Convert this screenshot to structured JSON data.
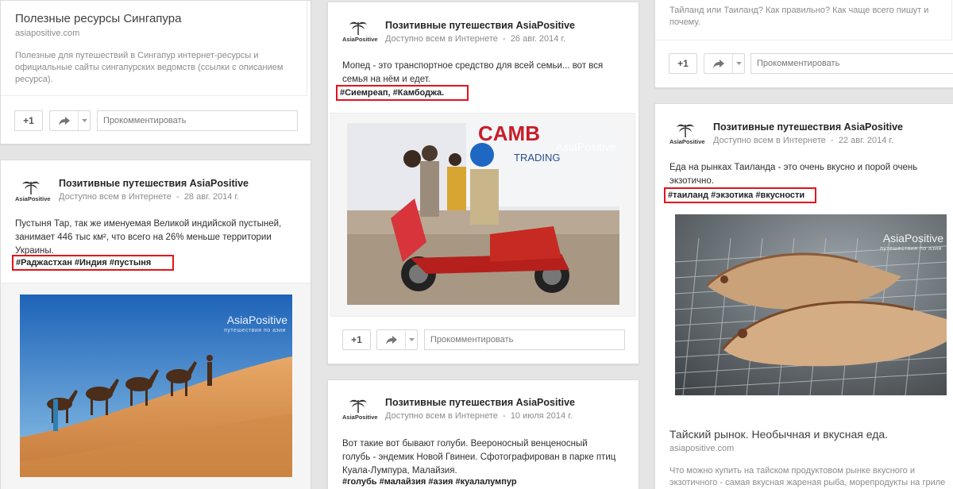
{
  "common": {
    "author": "Позитивные путешествия AsiaPositive",
    "visibility": "Доступно всем в Интернете",
    "plus_one": "+1",
    "comment_placeholder": "Прокомментировать",
    "logo_text": "AsiaPositive",
    "watermark": "AsiaPositive",
    "watermark_sub": "путешествия по азии"
  },
  "posts": [
    {
      "id": "singapore-resources",
      "link_title": "Полезные ресурсы Сингапура",
      "link_domain": "asiapositive.com",
      "link_desc": "Полезные для путешествий в Сингапур интернет-ресурсы и официальные сайты сингапурских ведомств (ссылки с описанием ресурса)."
    },
    {
      "id": "thar-desert",
      "date": "28 авг. 2014 г.",
      "text": "Пустыня Тар, так же именуемая Великой индийской пустыней, занимает 446 тыс км², что всего на 26% меньше территории Украины.",
      "tags": "#Раджастхан   #Индия   #пустыня",
      "photo_alt": "camels in desert"
    },
    {
      "id": "moped-cambodia",
      "date": "26 авг. 2014 г.",
      "text": "Мопед - это транспортное средство для всей семьи... вот вся семья на нём и едет.",
      "tags": "#Сиемреап, #Камбоджа.",
      "photo_alt": "family on moped",
      "sign_text": "CAMB",
      "sign_sub": "TRADING"
    },
    {
      "id": "pigeons",
      "date": "10 июля 2014 г.",
      "text": "Вот такие вот бывают голуби.  Веероносный венценосный голубь - эндемик Новой Гвинеи. Сфотографирован в парке птиц Куала-Лумпура, Малайзия.",
      "tags": "#голубь #малайзия  #азия  #куалалумпур"
    },
    {
      "id": "thailand-spelling",
      "text": "Тайланд или Таиланд? Как правильно? Как чаще всего пишут и почему."
    },
    {
      "id": "thai-market-fish",
      "date": "22 авг. 2014 г.",
      "text": "Еда на рынках Таиланда - это очень вкусно и порой очень экзотично.",
      "tags": "#таиланд #экзотика #вкусности",
      "photo_alt": "grilled fish",
      "link_title": "Тайский рынок. Необычная и вкусная еда.",
      "link_domain": "asiapositive.com",
      "link_desc": "Что можно купить на тайском продуктовом рынке вкусного и экзотичного - самая вкусная жареная рыба, морепродукты на гриле"
    }
  ],
  "colors": {
    "highlight": "#e3131b",
    "background": "#e5e5e5",
    "card": "#ffffff"
  }
}
